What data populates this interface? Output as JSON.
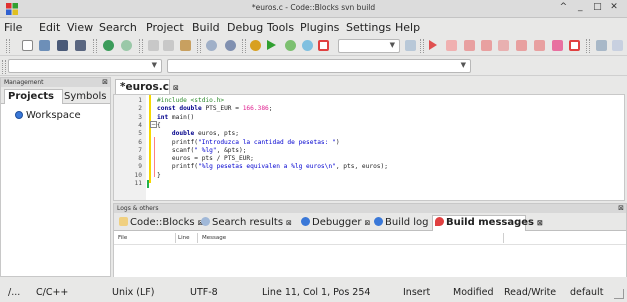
{
  "window": {
    "title": "*euros.c - Code::Blocks svn build",
    "controls": [
      "^",
      "_",
      "□",
      "✕"
    ]
  },
  "menu": [
    "File",
    "Edit",
    "View",
    "Search",
    "Project",
    "Build",
    "Debug",
    "Tools",
    "Plugins",
    "Settings",
    "Help"
  ],
  "management": {
    "header": "Management",
    "tabs": {
      "projects": "Projects",
      "symbols": "Symbols"
    },
    "workspace": "Workspace"
  },
  "editor": {
    "tab_label": "*euros.c",
    "lines": [
      {
        "num": "1",
        "parts": [
          [
            "pp",
            "#include <stdio.h>"
          ]
        ]
      },
      {
        "num": "2",
        "parts": [
          [
            "kw",
            "const double "
          ],
          [
            "",
            "PTS_EUR = "
          ],
          [
            "numc",
            "166.386"
          ],
          [
            "",
            ";"
          ]
        ]
      },
      {
        "num": "3",
        "parts": [
          [
            "kw",
            "int "
          ],
          [
            "",
            "main()"
          ]
        ]
      },
      {
        "num": "4",
        "parts": [
          [
            "",
            "{"
          ]
        ]
      },
      {
        "num": "5",
        "parts": [
          [
            "kw",
            "    double "
          ],
          [
            "",
            "euros, pts;"
          ]
        ]
      },
      {
        "num": "6",
        "parts": [
          [
            "",
            "    printf("
          ],
          [
            "str",
            "\"Introduzca la cantidad de pesetas: \""
          ],
          [
            "",
            ")"
          ]
        ]
      },
      {
        "num": "7",
        "parts": [
          [
            "",
            "    scanf("
          ],
          [
            "str",
            "\" %lg\""
          ],
          [
            "",
            ", &pts);"
          ]
        ]
      },
      {
        "num": "8",
        "parts": [
          [
            "",
            "    euros = pts / PTS_EUR;"
          ]
        ]
      },
      {
        "num": "9",
        "parts": [
          [
            "",
            "    printf("
          ],
          [
            "str",
            "\"%lg pesetas equivalen a %lg euros\\n\""
          ],
          [
            "",
            ", pts, euros);"
          ]
        ]
      },
      {
        "num": "10",
        "parts": [
          [
            "",
            "}"
          ]
        ]
      },
      {
        "num": "11",
        "parts": [
          [
            "",
            ""
          ]
        ]
      }
    ]
  },
  "logs": {
    "header": "Logs & others",
    "tabs": [
      "Code::Blocks",
      "Search results",
      "Debugger",
      "Build log",
      "Build messages"
    ],
    "columns": [
      "File",
      "Line",
      "Message"
    ]
  },
  "status": {
    "path": "/...",
    "language": "C/C++",
    "eol": "Unix (LF)",
    "encoding": "UTF-8",
    "position": "Line 11, Col 1, Pos 254",
    "mode": "Insert",
    "state": "Modified",
    "access": "Read/Write",
    "profile": "default"
  }
}
